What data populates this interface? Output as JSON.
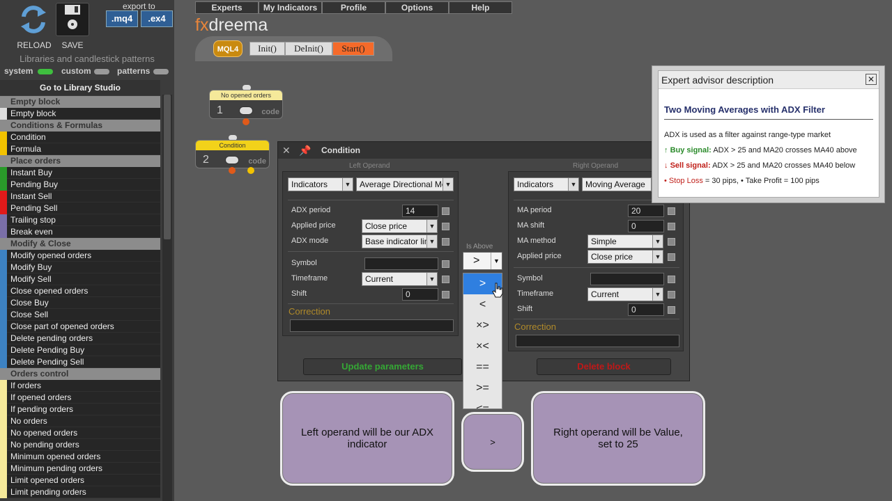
{
  "toolbar": {
    "reload_label": "RELOAD",
    "save_label": "SAVE",
    "export_label": "export to",
    "export_mq4": ".mq4",
    "export_ex4": ".ex4"
  },
  "sidebar": {
    "title": "Libraries and candlestick patterns",
    "toggles": [
      {
        "label": "system",
        "on": true
      },
      {
        "label": "custom",
        "on": false
      },
      {
        "label": "patterns",
        "on": false
      }
    ],
    "goto_label": "Go to Library Studio",
    "groups": [
      {
        "name": "Empty block",
        "color": "#dddddd",
        "items": [
          "Empty block"
        ]
      },
      {
        "name": "Conditions & Formulas",
        "color": "#f2c200",
        "items": [
          "Condition",
          "Formula"
        ]
      },
      {
        "name": "Place orders",
        "color": "#2a9a2a",
        "items": [
          "Instant Buy",
          "Pending Buy"
        ]
      },
      {
        "name": "",
        "color": "#e11a1a",
        "items": [
          "Instant Sell",
          "Pending Sell"
        ]
      },
      {
        "name": "",
        "color": "#7a6fa8",
        "items": [
          "Trailing stop",
          "Break even"
        ]
      },
      {
        "name": "Modify & Close",
        "color": "#3d82c2",
        "items": [
          "Modify opened orders",
          "Modify Buy",
          "Modify Sell",
          "Close opened orders",
          "Close Buy",
          "Close Sell",
          "Close part of opened orders",
          "Delete pending orders",
          "Delete Pending Buy",
          "Delete Pending Sell"
        ]
      },
      {
        "name": "Orders control",
        "color": "#f5e99a",
        "items": [
          "If orders",
          "If opened orders",
          "If pending orders",
          "No orders",
          "No opened orders",
          "No pending orders",
          "Minimum opened orders",
          "Minimum pending orders",
          "Limit opened orders",
          "Limit pending orders"
        ]
      }
    ]
  },
  "menu": [
    "Experts",
    "My Indicators",
    "Profile",
    "Options",
    "Help"
  ],
  "logo": {
    "fx": "fx",
    "rest": "dreema"
  },
  "tabs": {
    "mql4": "MQL4",
    "init": "Init()",
    "deinit": "DeInit()",
    "start": "Start()"
  },
  "blocks": [
    {
      "header": "No opened orders",
      "number": "1",
      "code": "code"
    },
    {
      "header": "Condition",
      "number": "2",
      "code": "code"
    }
  ],
  "dialog": {
    "title": "Condition",
    "left_label": "Left Operand",
    "right_label": "Right Operand",
    "left": {
      "type": "Indicators",
      "name": "Average Directional Movement Index",
      "params": [
        {
          "label": "ADX period",
          "value": "14",
          "kind": "input"
        },
        {
          "label": "Applied price",
          "value": "Close price",
          "kind": "select"
        },
        {
          "label": "ADX mode",
          "value": "Base indicator line",
          "kind": "select"
        }
      ],
      "common": [
        {
          "label": "Symbol",
          "value": "",
          "kind": "input"
        },
        {
          "label": "Timeframe",
          "value": "Current",
          "kind": "select"
        },
        {
          "label": "Shift",
          "value": "0",
          "kind": "input"
        }
      ],
      "correction_label": "Correction"
    },
    "right": {
      "type": "Indicators",
      "name": "Moving Average",
      "params": [
        {
          "label": "MA period",
          "value": "20",
          "kind": "input"
        },
        {
          "label": "MA shift",
          "value": "0",
          "kind": "input"
        },
        {
          "label": "MA method",
          "value": "Simple",
          "kind": "select"
        },
        {
          "label": "Applied price",
          "value": "Close price",
          "kind": "select"
        }
      ],
      "common": [
        {
          "label": "Symbol",
          "value": "",
          "kind": "input"
        },
        {
          "label": "Timeframe",
          "value": "Current",
          "kind": "select"
        },
        {
          "label": "Shift",
          "value": "0",
          "kind": "input"
        }
      ],
      "correction_label": "Correction"
    },
    "update_label": "Update parameters",
    "delete_label": "Delete block"
  },
  "operator": {
    "label": "Is Above",
    "selected": ">",
    "options": [
      ">",
      "<",
      "×>",
      "×<",
      "==",
      ">=",
      "<="
    ]
  },
  "description": {
    "window_title": "Expert advisor description",
    "title": "Two Moving Averages with ADX Filter",
    "line1": "ADX is used as a filter against range-type market",
    "buy_prefix": "↑",
    "buy_label": "Buy signal:",
    "buy_text": "ADX > 25 and MA20 crosses MA40 above",
    "sell_prefix": "↓",
    "sell_label": "Sell signal:",
    "sell_text": "ADX > 25 and MA20 crosses MA40 below",
    "sl_label": "Stop Loss",
    "sl_text": "= 30 pips,",
    "tp_label": "Take Profit",
    "tp_text": "= 100 pips"
  },
  "callouts": {
    "left": "Left operand will be our ADX indicator",
    "middle": ">",
    "right": "Right operand will be Value, set to 25"
  },
  "colors": {
    "accent": "#e8853a",
    "tab_start": "#f56a2a",
    "update_text": "#35a835",
    "delete_text": "#c01818",
    "selected_option": "#2f7fe0"
  }
}
